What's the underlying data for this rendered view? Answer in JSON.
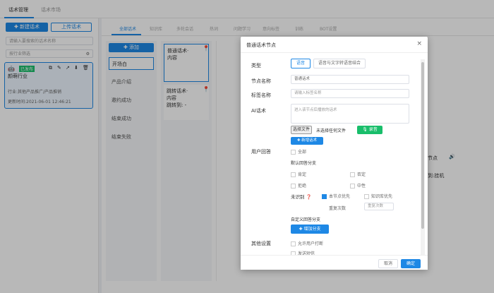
{
  "topnav": {
    "tabs": [
      "话术管理",
      "话术市场"
    ]
  },
  "left": {
    "new_btn": "新建话术",
    "upload_btn": "上传话术",
    "search_placeholder": "请输入要搜索的话术名称",
    "filter_placeholder": "按行业筛选",
    "card": {
      "tag": "已发布",
      "name": "颜萌行业",
      "industry": "行业:其他产品推广/产品推销",
      "updated": "更新时间:2021-06-01 12:46:21"
    }
  },
  "subtabs": [
    "全部话术",
    "知识库",
    "多轮会话",
    "热词",
    "问题学习",
    "意向标签",
    "训练",
    "BOT设置"
  ],
  "seq": {
    "add_btn": "添加",
    "items": [
      "开场白",
      "产品介绍",
      "邀约成功",
      "结束成功",
      "结束失败"
    ]
  },
  "nodes": [
    {
      "line1": "普通话术·",
      "line2": "内容",
      "line3": ""
    },
    {
      "line1": "跳转话术·",
      "line2": "内容",
      "line3": "跳转到: -"
    }
  ],
  "canvas": {
    "node_label": "节点",
    "node_sub": "到:挂机"
  },
  "dialog": {
    "title": "普通话术节点",
    "type_label": "类型",
    "type_opt1": "语音",
    "type_opt2": "语音与文字转语音结合",
    "node_name_label": "节点名称",
    "node_name_value": "普通话术",
    "tag_name_label": "标签名称",
    "tag_name_placeholder": "请输入标签名称",
    "ai_label": "AI话术",
    "ai_placeholder": "进入该节点后播放的话术",
    "file_btn": "选择文件",
    "file_none": "未选择任何文件",
    "record_btn": "录音",
    "add_script_btn": "新增话术",
    "reply_label": "用户回答",
    "all_opt": "全部",
    "default_branch": "默认回答分支",
    "branch": [
      "肯定",
      "否定",
      "拒绝",
      "中性"
    ],
    "unrecognized": "未识别",
    "node_first": "本节点优先",
    "kb_first": "知识库优先",
    "repeat_label": "重复次数",
    "repeat_value": "重复次数",
    "custom_branch": "自定义回答分支",
    "add_branch_btn": "增加分支",
    "other_label": "其他设置",
    "allow_interrupt": "允许用户打断",
    "send_sms": "发送短信",
    "cancel": "取消",
    "confirm": "确定"
  },
  "colors": {
    "accent": "#1e88e5",
    "green": "#19be6b"
  }
}
